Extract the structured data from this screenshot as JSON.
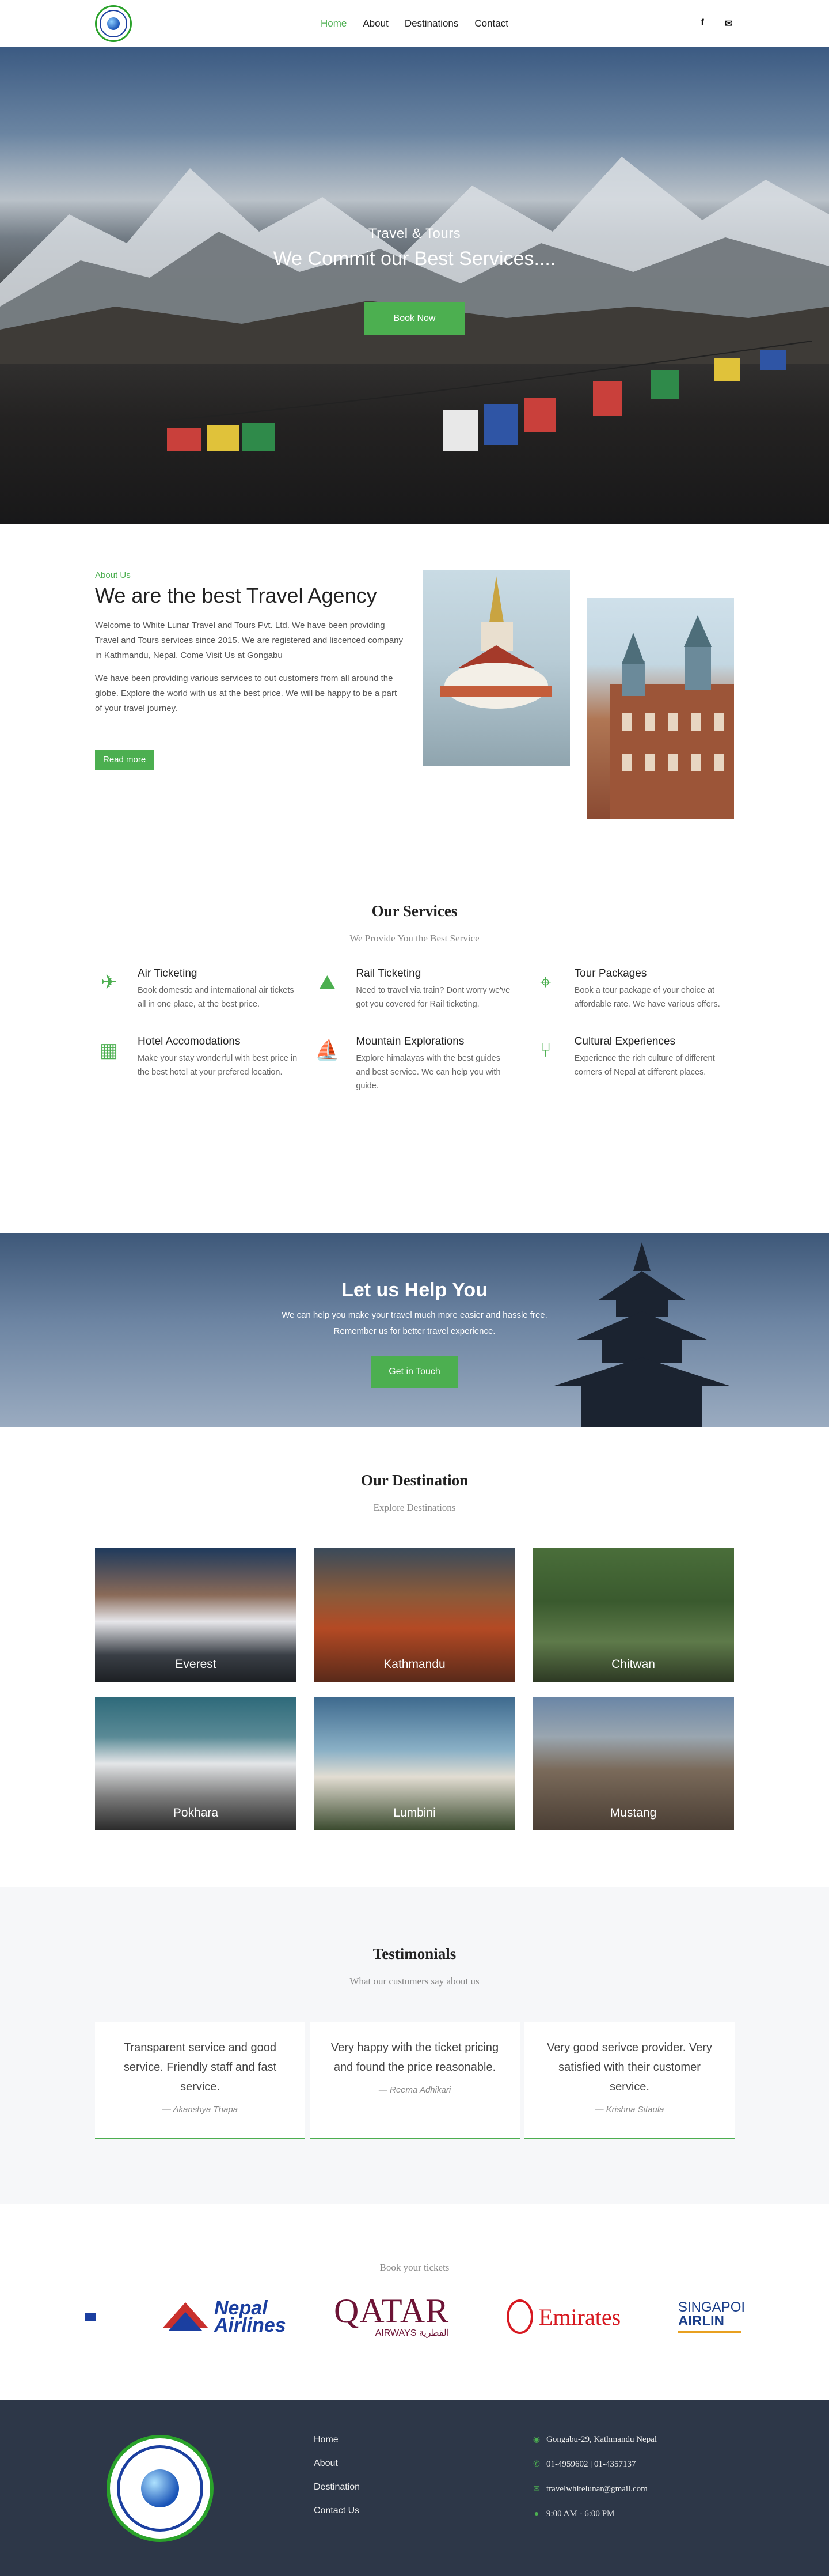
{
  "header": {
    "nav": [
      "Home",
      "About",
      "Destinations",
      "Contact"
    ],
    "social_icons": [
      "facebook-icon",
      "mail-icon"
    ]
  },
  "hero": {
    "subtitle": "Travel & Tours",
    "title": "We Commit our Best Services....",
    "cta": "Book Now"
  },
  "about": {
    "kicker": "About Us",
    "title": "We are the best Travel Agency",
    "p1": "Welcome to White Lunar Travel and Tours Pvt. Ltd. We have been providing Travel and Tours services since 2015. We are registered and liscenced company in Kathmandu, Nepal. Come Visit Us at Gongabu",
    "p2": "We have been providing various services to out customers from all around the globe. Explore the world with us at the best price. We will be happy to be a part of your travel journey.",
    "cta": "Read more"
  },
  "services": {
    "title": "Our Services",
    "subtitle": "We Provide You the Best Service",
    "items": [
      {
        "title": "Air Ticketing",
        "text": "Book domestic and international air tickets all in one place, at the best price.",
        "icon": "plane-icon"
      },
      {
        "title": "Rail Ticketing",
        "text": "Need to travel via train? Dont worry we've got you covered for Rail ticketing.",
        "icon": "train-icon"
      },
      {
        "title": "Tour Packages",
        "text": "Book a tour package of your choice at affordable rate. We have various offers.",
        "icon": "map-pin-icon"
      },
      {
        "title": "Hotel Accomodations",
        "text": "Make your stay wonderful with best price in the best hotel at your prefered location.",
        "icon": "hotel-icon"
      },
      {
        "title": "Mountain Explorations",
        "text": "Explore himalayas with the best guides and best service. We can help you with guide.",
        "icon": "sailboat-icon"
      },
      {
        "title": "Cultural Experiences",
        "text": "Experience the rich culture of different corners of Nepal at different places.",
        "icon": "cutlery-icon"
      }
    ]
  },
  "help": {
    "title": "Let us Help You",
    "line1": "We can help you make your travel much more easier and hassle free.",
    "line2": "Remember us for better travel experience.",
    "cta": "Get in Touch"
  },
  "destinations": {
    "title": "Our Destination",
    "subtitle": "Explore Destinations",
    "items": [
      "Everest",
      "Kathmandu",
      "Chitwan",
      "Pokhara",
      "Lumbini",
      "Mustang"
    ]
  },
  "testimonials": {
    "title": "Testimonials",
    "subtitle": "What our customers say about us",
    "items": [
      {
        "quote": "Transparent service and good service. Friendly staff and fast service.",
        "author": "— Akanshya Thapa"
      },
      {
        "quote": "Very happy with the ticket pricing and found the price reasonable.",
        "author": "— Reema Adhikari"
      },
      {
        "quote": "Very good serivce provider. Very satisfied with their customer service.",
        "author": "— Krishna Sitaula"
      }
    ]
  },
  "airlines": {
    "title": "Book your tickets",
    "logos": {
      "nepal_line1": "Nepal",
      "nepal_line2": "Airlines",
      "qatar_main": "QATAR",
      "qatar_sub": "AIRWAYS القطرية",
      "emirates": "Emirates",
      "singapore_line1": "SINGAPOI",
      "singapore_line2": "AIRLIN"
    }
  },
  "footer": {
    "links": [
      "Home",
      "About",
      "Destination",
      "Contact Us"
    ],
    "address": "Gongabu-29, Kathmandu Nepal",
    "phone": "01-4959602 | 01-4357137",
    "email": "travelwhitelunar@gmail.com",
    "hours": "9:00 AM - 6:00 PM"
  }
}
